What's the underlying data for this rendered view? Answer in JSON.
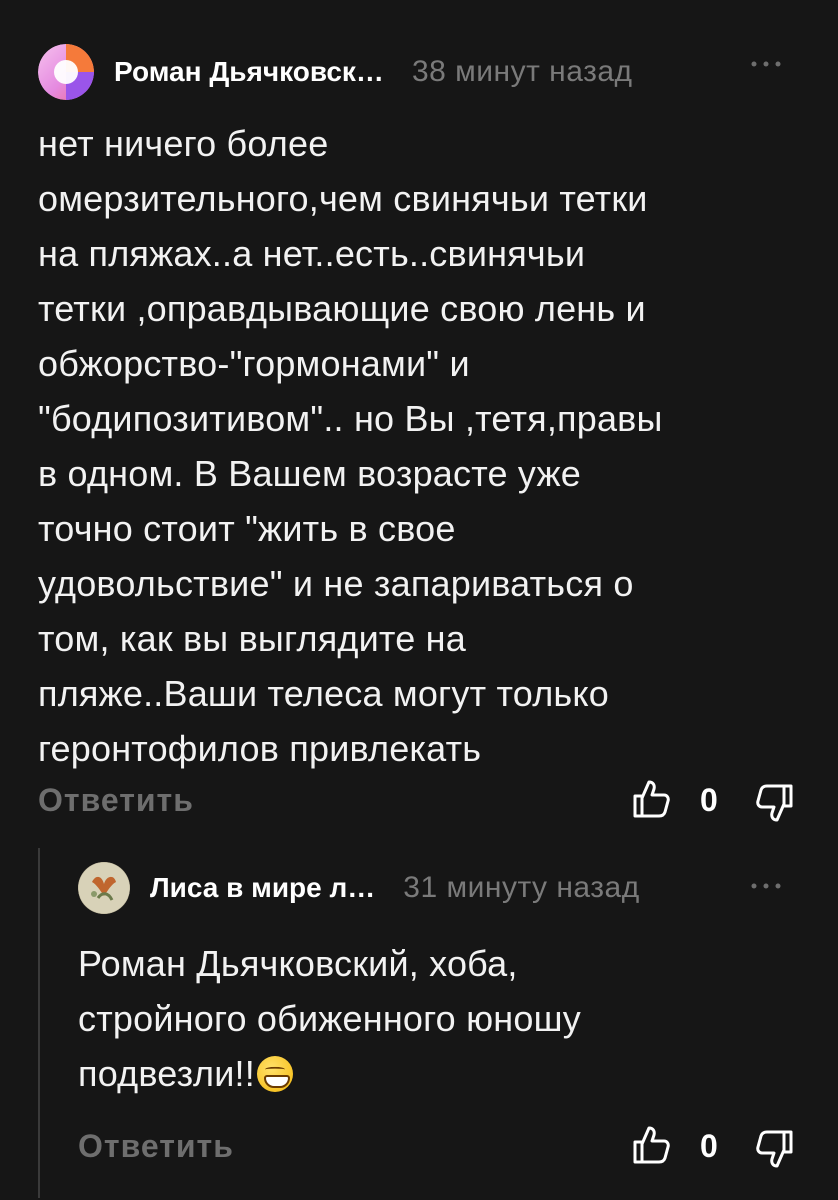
{
  "comments": [
    {
      "author": "Роман Дьячковск…",
      "time": "38 минут назад",
      "text": "нет ничего более\nомерзительного,чем свинячьи тетки\nна пляжах..а нет..есть..свинячьи\nтетки ,оправдывающие свою лень и\nобжорство-\"гормонами\" и\n\"бодипозитивом\".. но Вы ,тетя,правы\nв одном. В Вашем возрасте уже\nточно стоит \"жить в свое\nудовольствие\" и не запариваться о\nтом, как вы выглядите на\nпляже..Ваши телеса могут только\nгеронтофилов привлекать",
      "reply_label": "Ответить",
      "likes": "0"
    },
    {
      "author": "Лиса в мире л…",
      "time": "31 минуту назад",
      "text": "Роман Дьячковский, хоба,\nстройного обиженного юношу\nподвезли!!",
      "emoji": "grinning-face",
      "reply_label": "Ответить",
      "likes": "0"
    }
  ],
  "icons": {
    "more": "more-dots-icon",
    "like": "thumbs-up-icon",
    "dislike": "thumbs-down-icon"
  },
  "colors": {
    "background": "#161616",
    "text": "#f2f2f2",
    "muted": "#7a7a7a",
    "thread_line": "#3a3a3a"
  }
}
